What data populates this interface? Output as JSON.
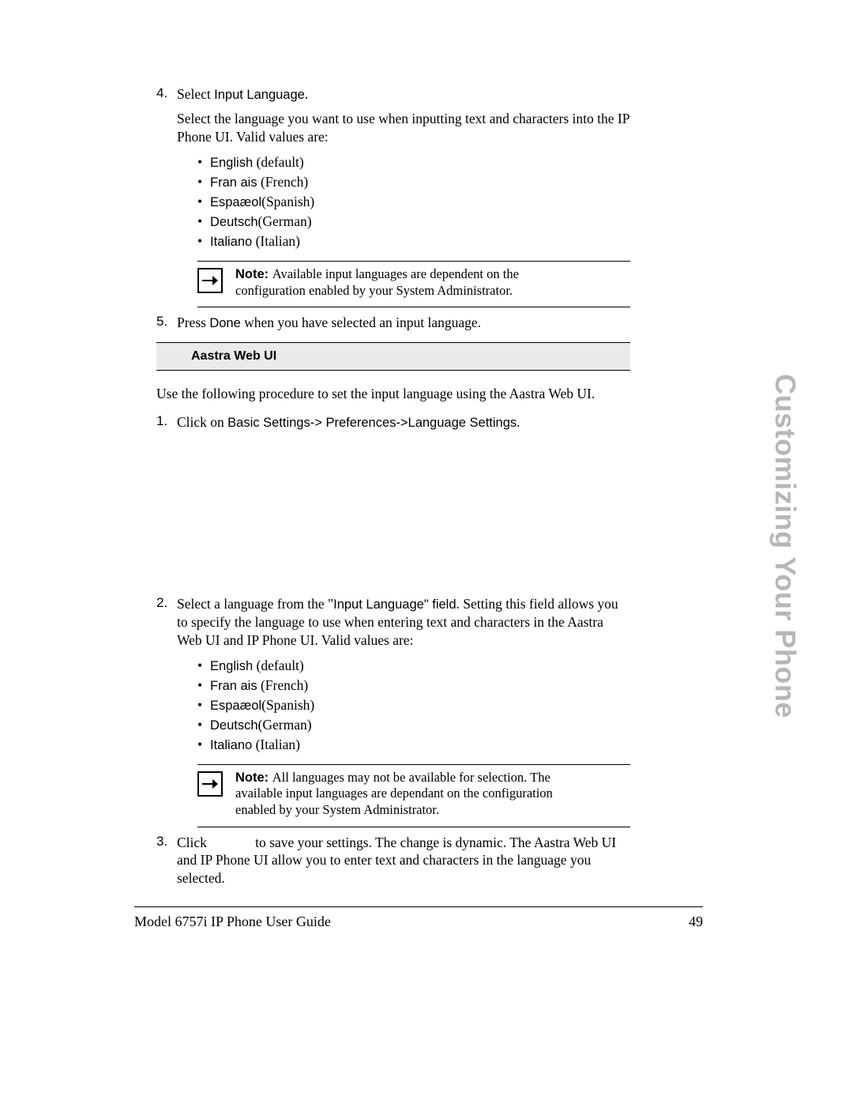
{
  "sideTitle": "Customizing Your Phone",
  "step4": {
    "num": "4.",
    "pre": "Select ",
    "bold": "Input Language",
    "post": ".",
    "para": "Select the language you want to use when inputting text and characters into the IP Phone UI. Valid values are:",
    "items": [
      {
        "bold": "English",
        "rest": " (default)"
      },
      {
        "bold": "Fran ais",
        "rest": " (French)"
      },
      {
        "bold": "Espaæol",
        "rest": "(Spanish)"
      },
      {
        "bold": "Deutsch",
        "rest": "(German)"
      },
      {
        "bold": "Italiano",
        "rest": " (Italian)"
      }
    ]
  },
  "note1": {
    "label": "Note: ",
    "text": "Available input languages are dependent on the configuration enabled by your System Administrator."
  },
  "step5": {
    "num": "5.",
    "pre": "Press ",
    "bold": "Done",
    "post": " when you have selected an input language."
  },
  "sectionTitle": "Aastra Web UI",
  "intro": "Use the following procedure to set the input language using the Aastra Web UI.",
  "step1": {
    "num": "1.",
    "pre": "Click on ",
    "bold": "Basic Settings-> Preferences->Language Settings",
    "post": "."
  },
  "step2": {
    "num": "2.",
    "pre": "Select a language from the \"",
    "bold": "Input Language",
    "mid": "\" field",
    "post": ". Setting this field allows you to specify the language to use when entering text and characters in the Aastra Web UI and IP Phone UI. Valid values are:",
    "items": [
      {
        "bold": "English",
        "rest": " (default)"
      },
      {
        "bold": "Fran ais",
        "rest": " (French)"
      },
      {
        "bold": "Espaæol",
        "rest": "(Spanish)"
      },
      {
        "bold": "Deutsch",
        "rest": "(German)"
      },
      {
        "bold": "Italiano",
        "rest": " (Italian)"
      }
    ]
  },
  "note2": {
    "label": "Note: ",
    "text": "All languages may not be available for selection. The available input languages are dependant on the configuration enabled by your System Administrator."
  },
  "step3": {
    "num": "3.",
    "text": "Click              to save your settings. The change is dynamic. The Aastra Web UI and IP Phone UI allow you to enter text and characters in the language you selected."
  },
  "footerLeft": "Model 6757i IP Phone User Guide",
  "footerRight": "49"
}
